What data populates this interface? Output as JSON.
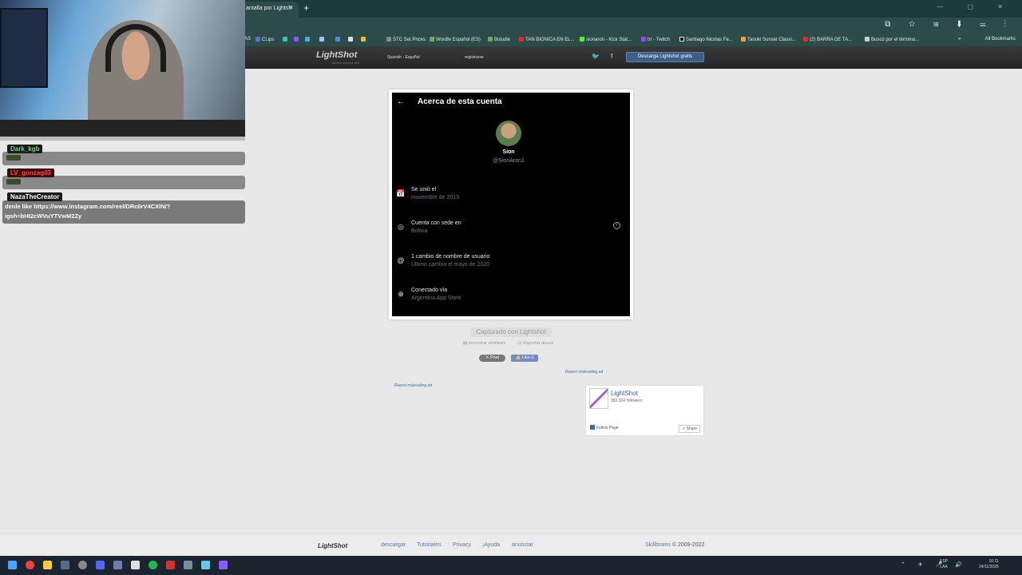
{
  "browser": {
    "tab_title": "antalla por Lightsh",
    "tab_close": "×",
    "new_tab": "+",
    "window_controls": "— ▢ ✕",
    "toolbar_icons": "⧉ ☆ ⊞ ⬇ ☰ ⋮",
    "bookmarks": [
      "AS",
      "CLips",
      "",
      "",
      "",
      "",
      "",
      "",
      "",
      "STC Set Prices",
      "Wordle Español (ES)",
      "Boludle",
      "TAN BIONICA EN EL...",
      "sionaron - Kick Stat...",
      "trr - Twitch",
      "Santiago Nicolas Fe...",
      "Tanuki Sunset Classi...",
      "(2) BARRA DE TA...",
      "Buscó por el término..."
    ],
    "bookmarks_more": "»",
    "all_bookmarks": "All Bookmarks"
  },
  "lightshot_header": {
    "logo": "LightShot",
    "logo_sub": "screen capture tool",
    "language": "Spanish - Español",
    "register": "registrarse",
    "social": "🐦 f",
    "download_button": "Descarga Lightshot gratis"
  },
  "capture": {
    "back_arrow": "←",
    "title": "Acerca de esta cuenta",
    "name": "Sion",
    "handle": "@SionAron1",
    "rows": [
      {
        "icon": "📅",
        "label": "Se unió el",
        "value": "noviembre de 2013"
      },
      {
        "icon": "◎",
        "label": "Cuenta con sede en",
        "value": "Bolivia"
      },
      {
        "icon": "@",
        "label": "1 cambio de nombre de usuario",
        "value": "Último cambio el mayo de 2020"
      },
      {
        "icon": "⊕",
        "label": "Conectado vía",
        "value": "Argentina App Store"
      }
    ],
    "info_icon": "i"
  },
  "below_capture": {
    "captured_by": "Capturado con Lightshot",
    "find_similar": "▤ encontrar similares",
    "report_abuse": "⊡ Reportar abuso",
    "post": "𝕏 Post",
    "like": "👍 Like 0",
    "report_ad_1": "Report misleading ad",
    "report_ad_2": "Report misleading ad"
  },
  "fb_widget": {
    "page_name": "LightShot",
    "followers": "383,324 followers",
    "follow": "Follow Page",
    "share": "↗ Share"
  },
  "footer": {
    "logo": "LightShot",
    "links": [
      "descargar",
      "Tutoriales",
      "Privacy",
      "¡Ayuda",
      "anunciar"
    ],
    "copyright_brand": "Skillbrains",
    "copyright_years": "© 2009-2022"
  },
  "chat": {
    "user1": "Dark_kgb",
    "user2": "LV_gonzag03",
    "user3": "NazaTheCreator",
    "message": "denle like  https://www.instagram.com/reel/DRc0rV4CXlN/?igsh=bHI2cWVuYTVwM2Zy",
    "colors": {
      "user1": "#7fd37f",
      "user2": "#ff4a4a",
      "user3": "#ffffff"
    }
  },
  "taskbar": {
    "tray": "⌃ ✈ 🎤 🔊",
    "lang_top": "ESP",
    "lang_bottom": "LAA",
    "time": "16:11",
    "date": "24/11/2025"
  }
}
